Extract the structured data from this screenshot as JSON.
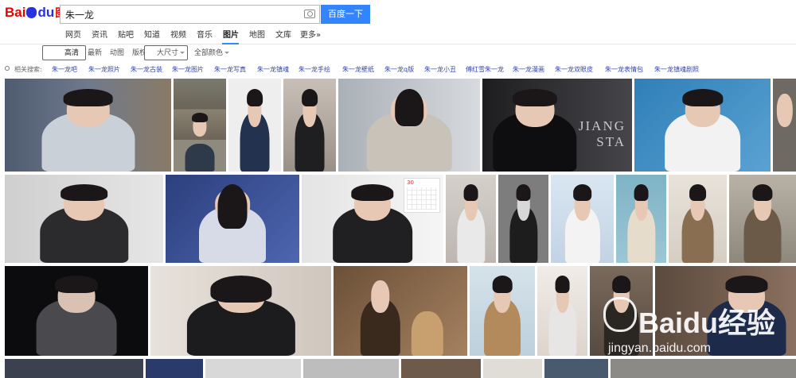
{
  "logo": {
    "bai": "Bai",
    "du": "du",
    "tupian": "图片"
  },
  "search": {
    "value": "朱一龙",
    "button": "百度一下"
  },
  "nav": {
    "items": [
      "网页",
      "资讯",
      "贴吧",
      "知道",
      "视频",
      "音乐",
      "图片",
      "地图",
      "文库",
      "更多»"
    ],
    "active": "图片"
  },
  "filters": {
    "hd": "高清",
    "latest": "最新",
    "animated": "动图",
    "copyright": "版权",
    "size": "大尺寸",
    "color": "全部颜色"
  },
  "related": {
    "label": "相关搜索:",
    "items": [
      "朱一龙吧",
      "朱一龙照片",
      "朱一龙古装",
      "朱一龙图片",
      "朱一龙写真",
      "朱一龙镇魂",
      "朱一龙手绘",
      "朱一龙壁纸",
      "朱一龙q版",
      "朱一龙小丑",
      "傅红雪朱一龙",
      "朱一龙漫画",
      "朱一龙双眼皮",
      "朱一龙表情包",
      "朱一龙镇魂剧照"
    ]
  },
  "tiles": {
    "jiangsta": "JIANG\nSTA",
    "calendar": "30"
  },
  "watermark": {
    "main": "Baidu经验",
    "url": "jingyan.baidu.com"
  },
  "colors": {
    "accent": "#3385ff",
    "highlight": "#e0332e",
    "logo_red": "#e10601",
    "logo_blue": "#2932e1"
  }
}
